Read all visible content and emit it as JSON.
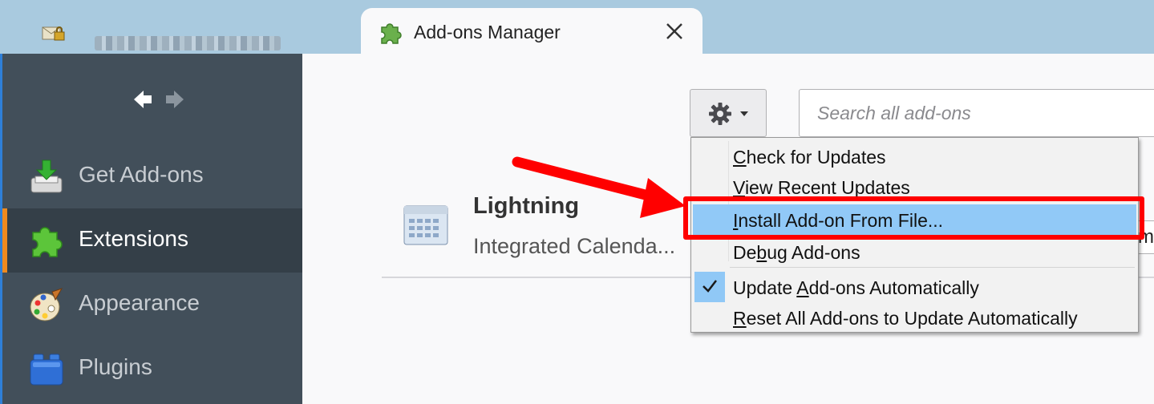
{
  "tabs": [
    {
      "label": "",
      "favicon": "envelope-lock-icon"
    },
    {
      "label": "Add-ons Manager",
      "favicon": "puzzle-piece-icon",
      "active": true
    }
  ],
  "sidebar": {
    "items": [
      {
        "label": "Get Add-ons",
        "icon": "download-tray-icon"
      },
      {
        "label": "Extensions",
        "icon": "puzzle-piece-icon",
        "selected": true
      },
      {
        "label": "Appearance",
        "icon": "palette-icon"
      },
      {
        "label": "Plugins",
        "icon": "lego-brick-icon"
      }
    ]
  },
  "toolbar": {
    "search_placeholder": "Search all add-ons"
  },
  "addon": {
    "name": "Lightning",
    "description": "Integrated Calenda...",
    "button_partial": "m"
  },
  "menu": {
    "items": [
      {
        "pre": "",
        "key": "C",
        "post": "heck for Updates"
      },
      {
        "pre": "",
        "key": "V",
        "post": "iew Recent Updates"
      },
      {
        "pre": "",
        "key": "I",
        "post": "nstall Add-on From File..."
      },
      {
        "pre": "De",
        "key": "b",
        "post": "ug Add-ons"
      },
      {
        "pre": "Update ",
        "key": "A",
        "post": "dd-ons Automatically",
        "checked": true
      },
      {
        "pre": "",
        "key": "R",
        "post": "eset All Add-ons to Update Automatically"
      }
    ]
  },
  "colors": {
    "highlight": "#91c9f7",
    "annotation_red": "#ff0000",
    "sidebar_bg": "#424f5a",
    "selected_accent": "#f08a1e"
  }
}
